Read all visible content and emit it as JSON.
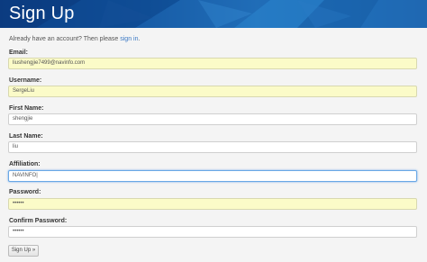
{
  "header": {
    "title": "Sign Up"
  },
  "intro": {
    "prefix": "Already have an account? Then please ",
    "link": "sign in",
    "suffix": "."
  },
  "form": {
    "email": {
      "label": "Email:",
      "value": "liushengjie7499@navinfo.com"
    },
    "username": {
      "label": "Username:",
      "value": "SergeLiu"
    },
    "first_name": {
      "label": "First Name:",
      "value": "shengjie"
    },
    "last_name": {
      "label": "Last Name:",
      "value": "liu"
    },
    "affiliation": {
      "label": "Affiliation:",
      "value": "NAVINFO|"
    },
    "password": {
      "label": "Password:",
      "value": "••••••"
    },
    "confirm_password": {
      "label": "Confirm Password:",
      "value": "••••••"
    },
    "submit_label": "Sign Up »"
  },
  "colors": {
    "banner": "#13569f",
    "autofill": "#fbfbc8",
    "link": "#3a78c4"
  }
}
